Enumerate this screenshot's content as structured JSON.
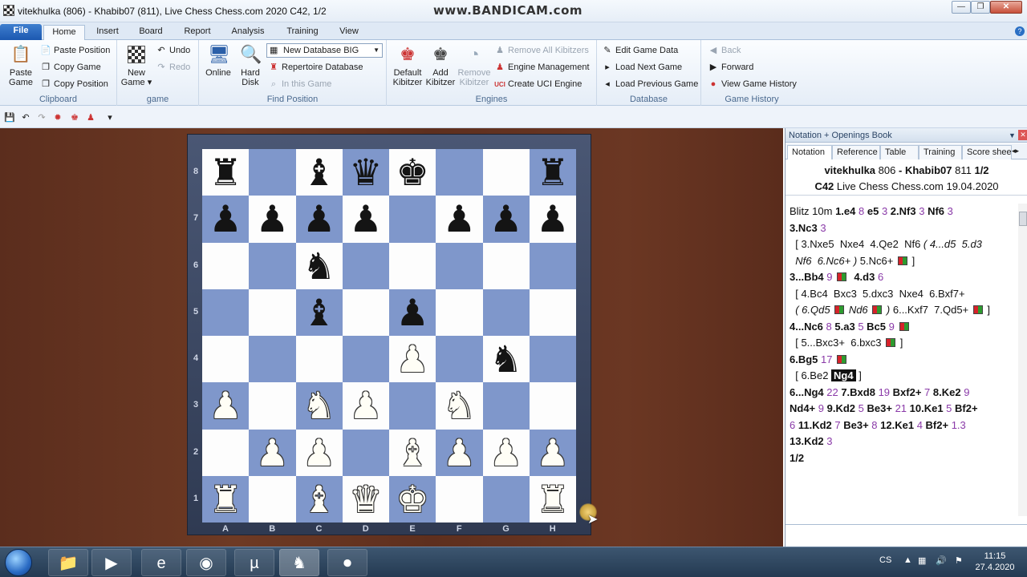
{
  "window": {
    "title": "vitekhulka (806) - Khabib07 (811), Live Chess Chess.com 2020  C42, 1/2",
    "watermark": "www.BANDICAM.com",
    "min": "—",
    "max": "❐",
    "close": "✕"
  },
  "ribbon_tabs": [
    "File",
    "Home",
    "Insert",
    "Board",
    "Report",
    "Analysis",
    "Training",
    "View"
  ],
  "help_icon": "?",
  "ribbon": {
    "clipboard": {
      "caption": "Clipboard",
      "paste_game": [
        "Paste",
        "Game"
      ],
      "paste_position": "Paste Position",
      "copy_game": "Copy Game",
      "copy_position": "Copy Position"
    },
    "game": {
      "caption": "game",
      "new_game": [
        "New",
        "Game ▾"
      ],
      "undo": "Undo",
      "redo": "Redo"
    },
    "find_position": {
      "caption": "Find Position",
      "online": "Online",
      "hard_disk": [
        "Hard",
        "Disk"
      ],
      "database_select": "New Database BIG",
      "repertoire": "Repertoire Database",
      "in_this_game": "In this Game"
    },
    "engines": {
      "caption": "Engines",
      "default_kibitzer": [
        "Default",
        "Kibitzer"
      ],
      "add_kibitzer": [
        "Add",
        "Kibitzer"
      ],
      "remove_kibitzer": [
        "Remove",
        "Kibitzer"
      ],
      "remove_all": "Remove All Kibitzers",
      "engine_management": "Engine Management",
      "create_uci": "Create UCI Engine"
    },
    "database": {
      "caption": "Database",
      "edit_game_data": "Edit Game Data",
      "load_next": "Load Next Game",
      "load_previous": "Load Previous Game"
    },
    "game_history": {
      "caption": "Game History",
      "back": "Back",
      "forward": "Forward",
      "view_history": "View Game History"
    }
  },
  "board": {
    "ranks": [
      "8",
      "7",
      "6",
      "5",
      "4",
      "3",
      "2",
      "1"
    ],
    "files": [
      "A",
      "B",
      "C",
      "D",
      "E",
      "F",
      "G",
      "H"
    ],
    "position": [
      [
        "bR",
        "",
        "bB",
        "bQ",
        "bK",
        "",
        "",
        "bR"
      ],
      [
        "bP",
        "bP",
        "bP",
        "bP",
        "",
        "bP",
        "bP",
        "bP"
      ],
      [
        "",
        "",
        "bN",
        "",
        "",
        "",
        "",
        ""
      ],
      [
        "",
        "",
        "bB",
        "",
        "bP",
        "",
        "",
        ""
      ],
      [
        "",
        "",
        "",
        "",
        "wP",
        "",
        "bN",
        ""
      ],
      [
        "wP",
        "",
        "wN",
        "wP",
        "",
        "wN",
        "",
        ""
      ],
      [
        "",
        "wP",
        "wP",
        "",
        "wB",
        "wP",
        "wP",
        "wP"
      ],
      [
        "wR",
        "",
        "wB",
        "wQ",
        "wK",
        "",
        "",
        "wR"
      ]
    ]
  },
  "notation": {
    "panel_title": "Notation + Openings Book",
    "tabs": [
      "Notation",
      "Reference",
      "Table",
      "Training",
      "Score shee"
    ],
    "white": "vitekhulka",
    "white_elo": "806",
    "sep": "-",
    "black": "Khabib07",
    "black_elo": "811",
    "result": "1/2",
    "eco": "C42",
    "event": "Live Chess Chess.com 19.04.2020"
  },
  "moves": [
    [
      [
        "Blitz 10m ",
        "n"
      ],
      [
        "1.e4",
        "m"
      ],
      [
        " 8 ",
        "t"
      ],
      [
        "e5",
        "m"
      ],
      [
        " 3 ",
        "t"
      ],
      [
        "2.Nf3",
        "m"
      ],
      [
        " 3 ",
        "t"
      ],
      [
        "Nf6",
        "m"
      ],
      [
        " 3",
        "t"
      ]
    ],
    [
      [
        "3.Nc3",
        "m"
      ],
      [
        " 3",
        "t"
      ]
    ],
    [
      [
        "  [ 3.Nxe5  Nxe4  4.Qe2  Nf6 ",
        "n"
      ],
      [
        "( 4...d5  5.d3",
        "i"
      ]
    ],
    [
      [
        "  ",
        "n"
      ],
      [
        "Nf6  6.Nc6+ )",
        "i"
      ],
      [
        " 5.Nc6+ ",
        "n"
      ],
      [
        "F",
        "f"
      ],
      [
        " ]",
        "n"
      ]
    ],
    [
      [
        "3...Bb4",
        "m"
      ],
      [
        " 9 ",
        "t"
      ],
      [
        "F",
        "f"
      ],
      [
        "  ",
        "n"
      ],
      [
        "4.d3",
        "m"
      ],
      [
        " 6",
        "t"
      ]
    ],
    [
      [
        "  [ 4.Bc4  Bxc3  5.dxc3  Nxe4  6.Bxf7+",
        "n"
      ]
    ],
    [
      [
        "  ",
        "n"
      ],
      [
        "( 6.Qd5 ",
        "i"
      ],
      [
        "F",
        "f"
      ],
      [
        " Nd6 ",
        "i"
      ],
      [
        "F",
        "f"
      ],
      [
        " )",
        "i"
      ],
      [
        " 6...Kxf7  7.Qd5+ ",
        "n"
      ],
      [
        "F",
        "f"
      ],
      [
        " ]",
        "n"
      ]
    ],
    [
      [
        "4...Nc6",
        "m"
      ],
      [
        " 8 ",
        "t"
      ],
      [
        "5.a3",
        "m"
      ],
      [
        " 5 ",
        "t"
      ],
      [
        "Bc5",
        "m"
      ],
      [
        " 9 ",
        "t"
      ],
      [
        "F",
        "f"
      ]
    ],
    [
      [
        "  [ 5...Bxc3+  6.bxc3 ",
        "n"
      ],
      [
        "F",
        "f"
      ],
      [
        " ]",
        "n"
      ]
    ],
    [
      [
        "6.Bg5",
        "m"
      ],
      [
        " 17 ",
        "t"
      ],
      [
        "F",
        "f"
      ]
    ],
    [
      [
        "  [ 6.Be2 ",
        "n"
      ],
      [
        "Ng4",
        "h"
      ],
      [
        " ]",
        "n"
      ]
    ],
    [
      [
        "6...Ng4",
        "m"
      ],
      [
        " 22 ",
        "t"
      ],
      [
        "7.Bxd8",
        "m"
      ],
      [
        " 19 ",
        "t"
      ],
      [
        "Bxf2+",
        "m"
      ],
      [
        " 7 ",
        "t"
      ],
      [
        "8.Ke2",
        "m"
      ],
      [
        " 9",
        "t"
      ]
    ],
    [
      [
        "Nd4+",
        "m"
      ],
      [
        " 9 ",
        "t"
      ],
      [
        "9.Kd2",
        "m"
      ],
      [
        " 5 ",
        "t"
      ],
      [
        "Be3+",
        "m"
      ],
      [
        " 21 ",
        "t"
      ],
      [
        "10.Ke1",
        "m"
      ],
      [
        " 5 ",
        "t"
      ],
      [
        "Bf2+",
        "m"
      ]
    ],
    [
      [
        "6 ",
        "t"
      ],
      [
        "11.Kd2",
        "m"
      ],
      [
        " 7 ",
        "t"
      ],
      [
        "Be3+",
        "m"
      ],
      [
        " 8 ",
        "t"
      ],
      [
        "12.Ke1",
        "m"
      ],
      [
        " 4 ",
        "t"
      ],
      [
        "Bf2+",
        "m"
      ],
      [
        " 1.3",
        "t"
      ]
    ],
    [
      [
        "13.Kd2",
        "m"
      ],
      [
        " 3",
        "t"
      ]
    ],
    [
      [
        "1/2",
        "m"
      ]
    ]
  ],
  "taskbar": {
    "lang": "CS",
    "time": "11:15",
    "date": "27.4.2020",
    "items": [
      "explorer-icon",
      "media-player-icon",
      "ie-icon",
      "chrome-icon",
      "utorrent-icon",
      "chessbase-icon",
      "bandicam-icon"
    ]
  }
}
